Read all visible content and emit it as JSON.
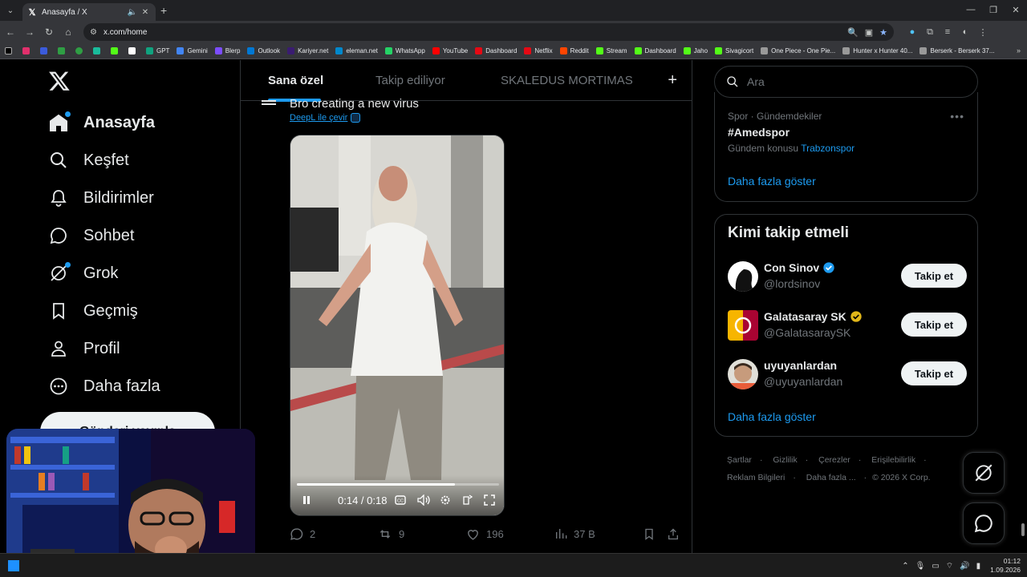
{
  "browser": {
    "tab_title": "Anasayfa / X",
    "url": "x.com/home",
    "bookmarks": [
      "GPT",
      "Gemini",
      "Blerp",
      "Outlook",
      "Kariyer.net",
      "eleman.net",
      "WhatsApp",
      "YouTube",
      "Dashboard",
      "Netflix",
      "Reddit",
      "Stream",
      "Dashboard",
      "Jaho",
      "Sivagicort",
      "One Piece - One Pie...",
      "Hunter x Hunter 40...",
      "Berserk - Berserk 37..."
    ],
    "bookmark_colors": [
      "#10a37f",
      "#4285f4",
      "#7c4dff",
      "#0078d4",
      "#3a1c71",
      "#0088cc",
      "#25d366",
      "#ff0000",
      "#e50914",
      "#e50914",
      "#ff4500",
      "#53fc18",
      "#53fc18",
      "#53fc18",
      "#53fc18",
      "#999999",
      "#999999",
      "#999999"
    ]
  },
  "nav": {
    "items": [
      "Anasayfa",
      "Keşfet",
      "Bildirimler",
      "Sohbet",
      "Grok",
      "Geçmiş",
      "Profil",
      "Daha fazla"
    ],
    "post_button": "Gönderi yayınla"
  },
  "feed": {
    "tabs": [
      "Sana özel",
      "Takip ediliyor",
      "SKALEDUS MORTIMAS"
    ],
    "tweet_text": "Bro creating a new virus",
    "translate": "DeepL ile çevir",
    "video": {
      "time": "0:14 / 0:18",
      "progress": 0.78
    },
    "stats": {
      "replies": "2",
      "reposts": "9",
      "likes": "196",
      "views": "37 B"
    }
  },
  "right": {
    "search_placeholder": "Ara",
    "trend": {
      "category": "Spor · Gündemdekiler",
      "name": "#Amedspor",
      "meta_prefix": "Gündem konusu",
      "meta_link": "Trabzonspor",
      "show_more": "Daha fazla göster"
    },
    "who_to_follow": {
      "title": "Kimi takip etmeli",
      "users": [
        {
          "name": "Con Sinov",
          "handle": "@lordsinov",
          "badge": "blue",
          "button": "Takip et"
        },
        {
          "name": "Galatasaray SK",
          "handle": "@GalatasaraySK",
          "badge": "gold",
          "button": "Takip et"
        },
        {
          "name": "uyuyanlardan",
          "handle": "@uyuyanlardan",
          "badge": "",
          "button": "Takip et"
        }
      ],
      "show_more": "Daha fazla göster"
    },
    "footer": {
      "links": [
        "Şartlar",
        "Gizlilik",
        "Çerezler",
        "Erişilebilirlik",
        "Reklam Bilgileri",
        "Daha fazla ..."
      ],
      "copyright": "© 2026 X Corp."
    }
  },
  "taskbar": {
    "time": "01:12",
    "date": "1.09.2026"
  },
  "colors": {
    "accent": "#1d9bf0",
    "background": "#000000",
    "border": "#2f3336",
    "muted": "#71767b"
  }
}
